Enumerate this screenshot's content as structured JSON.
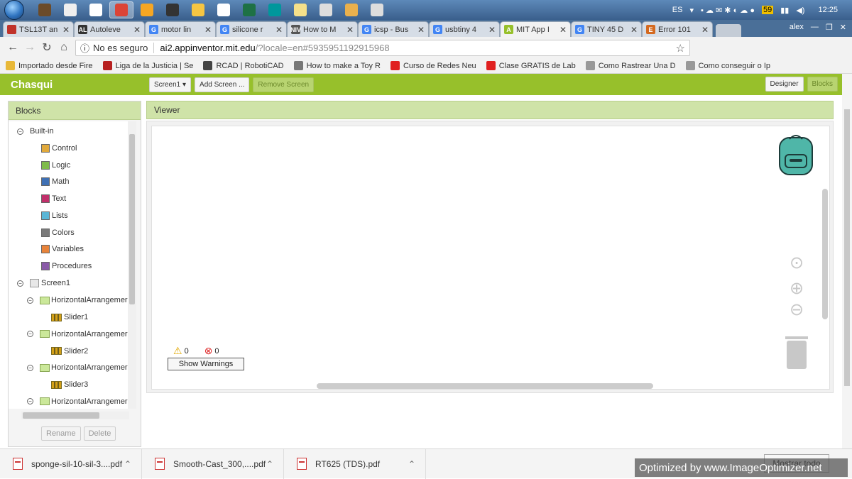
{
  "taskbar": {
    "apps": [
      "hat",
      "calc",
      "IQ",
      "chrome",
      "media",
      "folder-b",
      "explorer",
      "cmd",
      "excel",
      "arduino",
      "paint",
      "tool",
      "spark",
      "notepad"
    ],
    "tray": {
      "lang": "ES",
      "badge": "59",
      "time": "12:25"
    }
  },
  "browser": {
    "tabs": [
      {
        "label": "TSL13T an",
        "fav_color": "#c0322a"
      },
      {
        "label": "Autoleve",
        "fav_color": "#333333",
        "fav": "AL"
      },
      {
        "label": "motor lin",
        "fav_color": "#4285f4",
        "fav": "G"
      },
      {
        "label": "silicone r",
        "fav_color": "#4285f4",
        "fav": "G"
      },
      {
        "label": "How to M",
        "fav_color": "#555555",
        "fav": "NIV"
      },
      {
        "label": "icsp - Bus",
        "fav_color": "#4285f4",
        "fav": "G"
      },
      {
        "label": "usbtiny 4",
        "fav_color": "#4285f4",
        "fav": "G"
      },
      {
        "label": "MIT App I",
        "fav_color": "#97c02b",
        "fav": "A",
        "active": true
      },
      {
        "label": "TINY 45 D",
        "fav_color": "#4285f4",
        "fav": "G"
      },
      {
        "label": "Error 101",
        "fav_color": "#d4691f",
        "fav": "E"
      }
    ],
    "profile": "alex",
    "security_label": "No es seguro",
    "url_domain": "ai2.appinventor.mit.edu",
    "url_path": "/?locale=en#5935951192915968",
    "bookmarks": [
      {
        "label": "Importado desde Fire",
        "color": "#e8b838"
      },
      {
        "label": "Liga de la Justicia | Se",
        "color": "#b72020"
      },
      {
        "label": "RCAD | RobotiCAD",
        "color": "#444444"
      },
      {
        "label": "How to make a Toy R",
        "color": "#777777"
      },
      {
        "label": "Curso de Redes Neu",
        "color": "#e02020"
      },
      {
        "label": "Clase GRATIS de Lab",
        "color": "#e02020"
      },
      {
        "label": "Como Rastrear Una D",
        "color": "#999999"
      },
      {
        "label": "Como conseguir o Ip",
        "color": "#999999"
      }
    ]
  },
  "app": {
    "title": "Chasqui",
    "screen_select": "Screen1 ▾",
    "add_screen": "Add Screen ...",
    "remove_screen": "Remove Screen",
    "designer": "Designer",
    "blocks": "Blocks",
    "accent": "#97c02b"
  },
  "blocks_panel": {
    "header": "Blocks",
    "builtin": "Built-in",
    "categories": [
      {
        "label": "Control",
        "color": "#e1a93b"
      },
      {
        "label": "Logic",
        "color": "#7fbb4a"
      },
      {
        "label": "Math",
        "color": "#3f70b4"
      },
      {
        "label": "Text",
        "color": "#c1306b"
      },
      {
        "label": "Lists",
        "color": "#5ab6d6"
      },
      {
        "label": "Colors",
        "color": "#7a7a7a"
      },
      {
        "label": "Variables",
        "color": "#e8833a"
      },
      {
        "label": "Procedures",
        "color": "#8a5aa8"
      }
    ],
    "screen": "Screen1",
    "components": [
      {
        "label": "HorizontalArrangemer",
        "child": "Slider1"
      },
      {
        "label": "HorizontalArrangemer",
        "child": "Slider2"
      },
      {
        "label": "HorizontalArrangemer",
        "child": "Slider3"
      },
      {
        "label": "HorizontalArrangemer",
        "child": ""
      }
    ],
    "rename": "Rename",
    "delete": "Delete"
  },
  "viewer": {
    "header": "Viewer",
    "warnings_count": "0",
    "errors_count": "0",
    "show_warnings": "Show Warnings"
  },
  "downloads": [
    {
      "label": "sponge-sil-10-sil-3....pdf"
    },
    {
      "label": "Smooth-Cast_300,....pdf"
    },
    {
      "label": "RT625 (TDS).pdf"
    }
  ],
  "downloads_show_all": "Mostrar todo",
  "watermark": "Optimized by www.ImageOptimizer.net"
}
